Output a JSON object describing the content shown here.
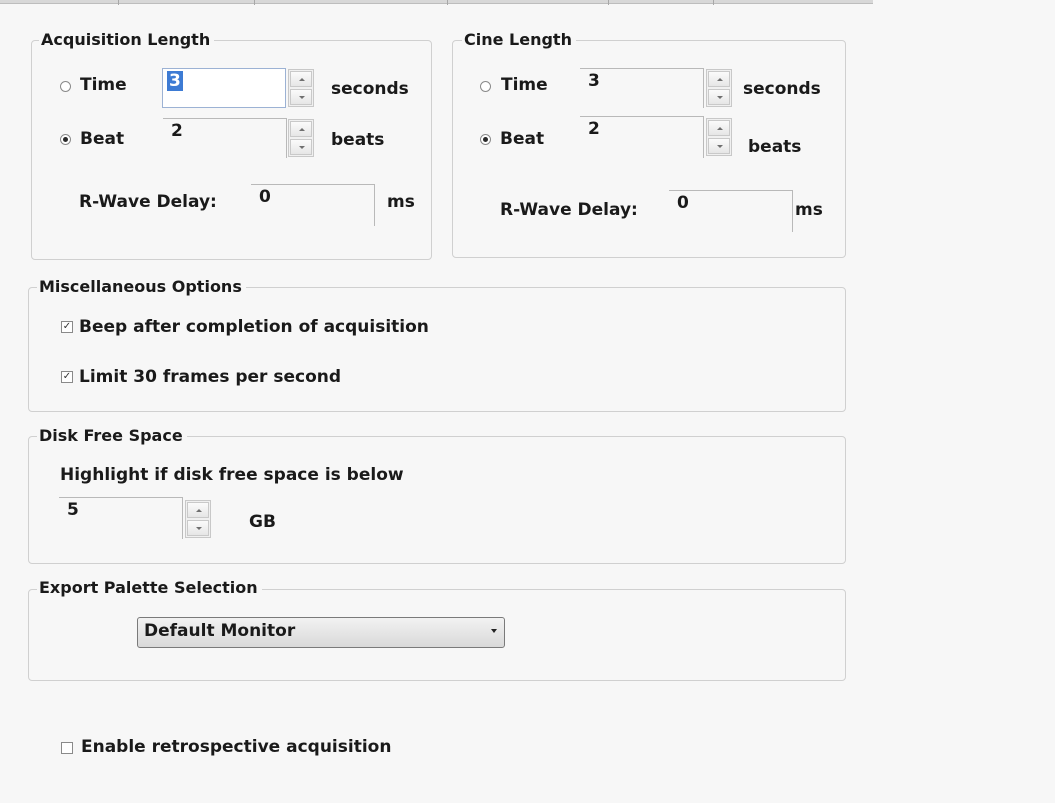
{
  "acquisition_length": {
    "title": "Acquisition Length",
    "time_label": "Time",
    "time_value": "3",
    "time_unit": "seconds",
    "beat_label": "Beat",
    "beat_value": "2",
    "beat_unit": "beats",
    "selected_mode": "Beat",
    "rwave_label": "R-Wave Delay:",
    "rwave_value": "0",
    "rwave_unit": "ms"
  },
  "cine_length": {
    "title": "Cine Length",
    "time_label": "Time",
    "time_value": "3",
    "time_unit": "seconds",
    "beat_label": "Beat",
    "beat_value": "2",
    "beat_unit": "beats",
    "selected_mode": "Beat",
    "rwave_label": "R-Wave Delay:",
    "rwave_value": "0",
    "rwave_unit": "ms"
  },
  "misc_options": {
    "title": "Miscellaneous Options",
    "beep_label": "Beep after completion of acquisition",
    "beep_checked": true,
    "limit_label": "Limit 30 frames per second",
    "limit_checked": true
  },
  "disk_free_space": {
    "title": "Disk Free Space",
    "description": "Highlight if disk free space is below",
    "value": "5",
    "unit": "GB"
  },
  "export_palette": {
    "title": "Export Palette Selection",
    "selected": "Default Monitor"
  },
  "retrospective": {
    "label": "Enable retrospective acquisition",
    "checked": false
  },
  "icons": {
    "check_glyph": "✓"
  }
}
